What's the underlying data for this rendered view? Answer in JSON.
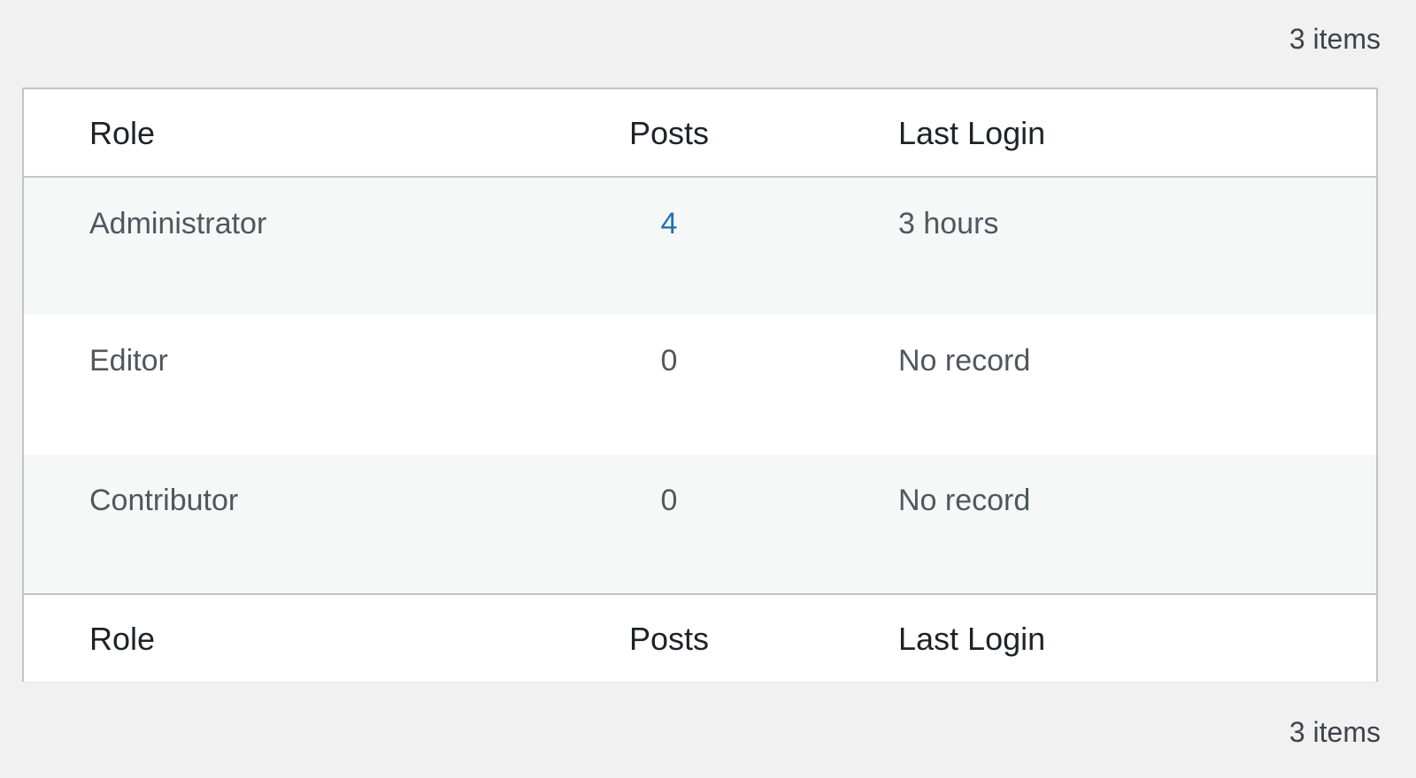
{
  "item_count": "3 items",
  "columns": {
    "role": "Role",
    "posts": "Posts",
    "last_login": "Last Login"
  },
  "rows": [
    {
      "role": "Administrator",
      "posts": "4",
      "last_login": "3 hours"
    },
    {
      "role": "Editor",
      "posts": "0",
      "last_login": "No record"
    },
    {
      "role": "Contributor",
      "posts": "0",
      "last_login": "No record"
    }
  ],
  "colors": {
    "link": "#2271b1",
    "border": "#c3c4c7",
    "stripe": "#f6f7f7",
    "background": "#f1f1f1"
  }
}
